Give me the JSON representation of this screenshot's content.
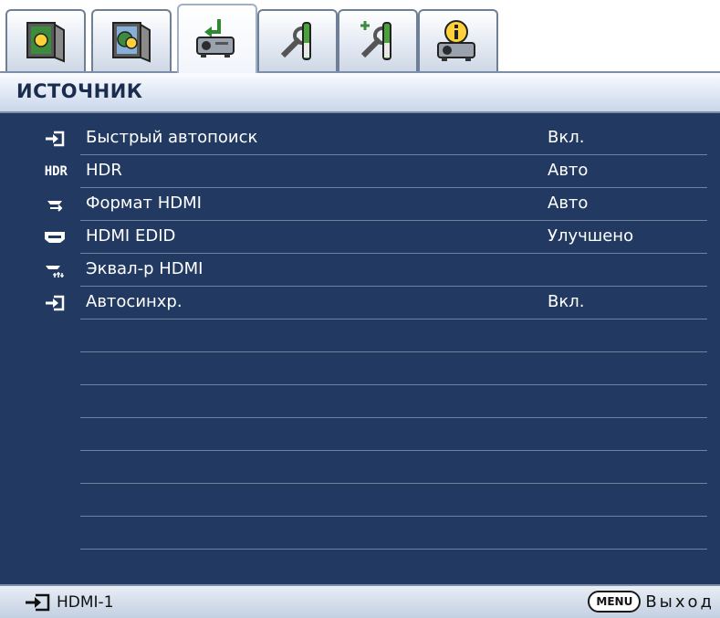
{
  "tabs": [
    {
      "icon": "picture-icon",
      "active": false
    },
    {
      "icon": "picture-advanced-icon",
      "active": false
    },
    {
      "icon": "source-icon",
      "active": true
    },
    {
      "icon": "setup-basic-icon",
      "active": false
    },
    {
      "icon": "setup-advanced-icon",
      "active": false
    },
    {
      "icon": "information-icon",
      "active": false
    }
  ],
  "header": {
    "title": "ИСТОЧНИК"
  },
  "menu": {
    "items": [
      {
        "icon": "input-arrow-icon",
        "label": "Быстрый автопоиск",
        "value": "Вкл."
      },
      {
        "icon": "hdr-icon",
        "icon_text": "HDR",
        "label": "HDR",
        "value": "Авто"
      },
      {
        "icon": "hdmi-format-icon",
        "label": "Формат HDMI",
        "value": "Авто"
      },
      {
        "icon": "hdmi-edid-icon",
        "label": "HDMI EDID",
        "value": "Улучшено"
      },
      {
        "icon": "hdmi-equalizer-icon",
        "label": "Эквал-р HDMI",
        "value": ""
      },
      {
        "icon": "input-arrow-icon",
        "label": "Автосинхр.",
        "value": "Вкл."
      }
    ]
  },
  "footer": {
    "source_icon": "input-arrow-icon",
    "source": "HDMI-1",
    "menu_button": "MENU",
    "exit": "Выход"
  },
  "colors": {
    "menu_background": "#223a62",
    "header_text": "#1b2d4e",
    "divider": "#6f829f"
  }
}
